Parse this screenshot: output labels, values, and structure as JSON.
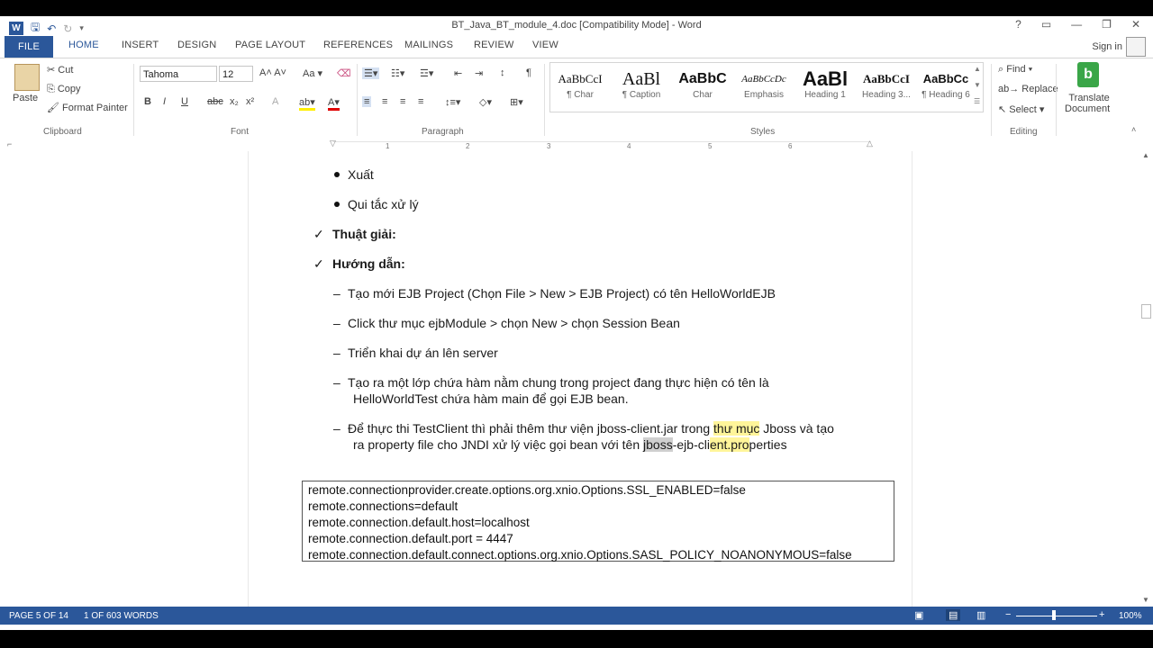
{
  "app": {
    "title": "BT_Java_BT_module_4.doc [Compatibility Mode] - Word",
    "window_controls": [
      "?",
      "▭",
      "—",
      "❐",
      "✕"
    ],
    "accent": "#2b579a"
  },
  "tabs": [
    "FILE",
    "HOME",
    "INSERT",
    "DESIGN",
    "PAGE LAYOUT",
    "REFERENCES",
    "MAILINGS",
    "REVIEW",
    "VIEW"
  ],
  "active_tab": "HOME",
  "signin": "Sign in",
  "ribbon": {
    "clipboard": {
      "label": "Clipboard",
      "paste": "Paste",
      "cut": "Cut",
      "copy": "Copy",
      "format_painter": "Format Painter"
    },
    "font": {
      "label": "Font",
      "family": "Tahoma",
      "size": "12"
    },
    "paragraph": {
      "label": "Paragraph"
    },
    "styles": {
      "label": "Styles",
      "items": [
        {
          "preview": "AaBbCcI",
          "name": "¶ Char"
        },
        {
          "preview": "AaBl",
          "name": "¶ Caption"
        },
        {
          "preview": "AaBbC",
          "name": "Char"
        },
        {
          "preview": "AaBbCcDc",
          "name": "Emphasis"
        },
        {
          "preview": "AaBl",
          "name": "Heading 1"
        },
        {
          "preview": "AaBbCcI",
          "name": "Heading 3..."
        },
        {
          "preview": "AaBbCc",
          "name": "¶ Heading 6"
        }
      ]
    },
    "editing": {
      "label": "Editing",
      "find": "Find",
      "replace": "Replace",
      "select": "Select"
    },
    "translate": {
      "line1": "Translate",
      "line2": "Document"
    }
  },
  "ruler_numbers": [
    "1",
    "2",
    "3",
    "4",
    "5",
    "6"
  ],
  "document": {
    "bullets": [
      "Xuất",
      "Qui tắc xử lý"
    ],
    "checks": [
      "Thuật giải:",
      "Hướng dẫn:"
    ],
    "dash_items": [
      {
        "l1": "Tạo mới EJB Project (Chọn File > New > EJB Project) có tên HelloWorldEJB"
      },
      {
        "l1": "Click thư mục ejbModule > chọn New > chọn Session Bean"
      },
      {
        "l1": "Triển khai dự án lên server"
      },
      {
        "l1": "Tạo ra một lớp chứa hàm nằm chung trong project đang thực hiện có tên là",
        "l2": "HelloWorldTest chứa hàm main để gọi EJB bean."
      },
      {
        "l1a": "Để thực thi TestClient thì phải thêm thư viện jboss-client.jar trong ",
        "l1b": "thư mục",
        "l1c": " Jboss và tạo",
        "l2a": "ra property file cho JNDI xử lý việc gọi bean với tên ",
        "l2b": "jboss",
        "l2c": "-ejb-cli",
        "l2d": "ent.pro",
        "l2e": "perties"
      }
    ],
    "code": [
      "remote.connectionprovider.create.options.org.xnio.Options.SSL_ENABLED=false",
      "remote.connections=default",
      "remote.connection.default.host=localhost",
      "remote.connection.default.port = 4447",
      "remote.connection.default.connect.options.org.xnio.Options.SASL_POLICY_NOANONYMOUS=false"
    ]
  },
  "status": {
    "page": "PAGE 5 OF 14",
    "words": "1 OF 603 WORDS",
    "zoom": "100%",
    "zoom_minus": "−",
    "zoom_plus": "+"
  }
}
